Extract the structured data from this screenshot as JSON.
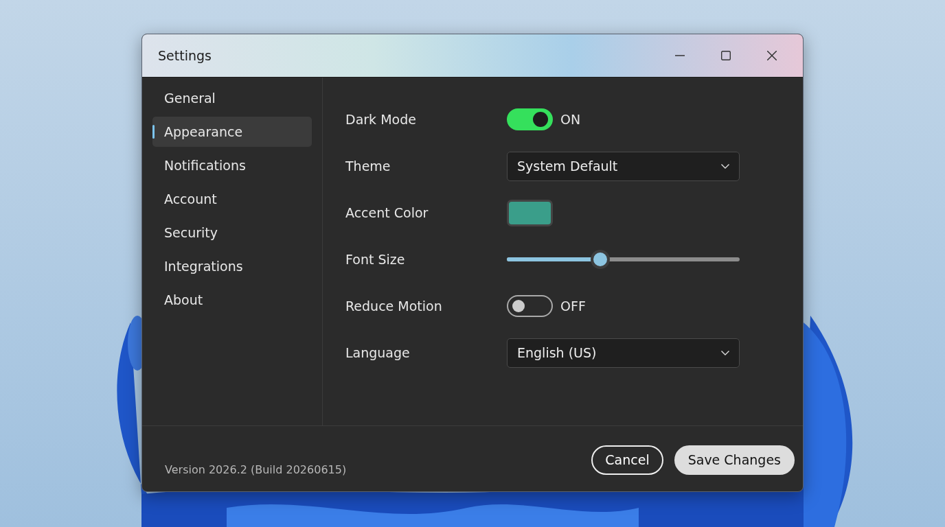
{
  "window": {
    "title": "Settings"
  },
  "sidebar": {
    "items": [
      {
        "label": "General",
        "selected": false
      },
      {
        "label": "Appearance",
        "selected": true
      },
      {
        "label": "Notifications",
        "selected": false
      },
      {
        "label": "Account",
        "selected": false
      },
      {
        "label": "Security",
        "selected": false
      },
      {
        "label": "Integrations",
        "selected": false
      },
      {
        "label": "About",
        "selected": false
      }
    ]
  },
  "settings": [
    {
      "kind": "toggle",
      "label": "Dark Mode",
      "on": true,
      "state_text": "ON"
    },
    {
      "kind": "dropdown",
      "label": "Theme",
      "value": "System Default"
    },
    {
      "kind": "color",
      "label": "Accent Color",
      "color": "#3a9e8a"
    },
    {
      "kind": "slider",
      "label": "Font Size",
      "level": 0.4
    },
    {
      "kind": "toggle",
      "label": "Reduce Motion",
      "on": false,
      "state_text": "OFF"
    },
    {
      "kind": "dropdown",
      "label": "Language",
      "value": "English (US)"
    }
  ],
  "footer": {
    "version": "Version 2026.2 (Build 20260615)",
    "buttons": [
      {
        "label": "Cancel",
        "kind": "secondary"
      },
      {
        "label": "Save Changes",
        "kind": "primary"
      }
    ]
  }
}
